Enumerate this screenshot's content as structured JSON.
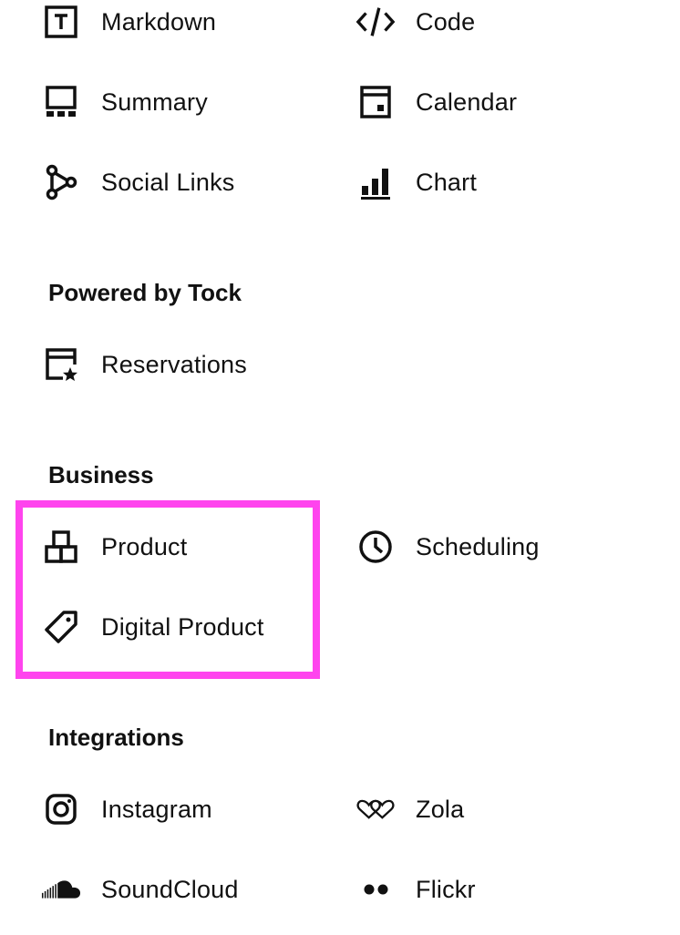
{
  "layouts": {
    "markdown": "Markdown",
    "code": "Code",
    "summary": "Summary",
    "calendar": "Calendar",
    "social_links": "Social Links",
    "chart": "Chart"
  },
  "tock": {
    "heading": "Powered by Tock",
    "reservations": "Reservations"
  },
  "business": {
    "heading": "Business",
    "product": "Product",
    "scheduling": "Scheduling",
    "digital_product": "Digital Product"
  },
  "integrations": {
    "heading": "Integrations",
    "instagram": "Instagram",
    "zola": "Zola",
    "soundcloud": "SoundCloud",
    "flickr": "Flickr"
  },
  "colors": {
    "highlight": "#ff44ee",
    "text": "#111111"
  }
}
